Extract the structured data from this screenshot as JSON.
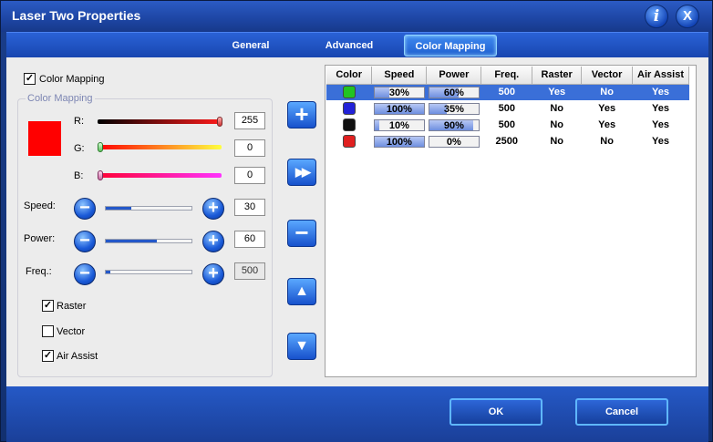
{
  "window": {
    "title": "Laser Two Properties",
    "info_icon": "i",
    "close_icon": "X"
  },
  "tabs": [
    {
      "label": "General"
    },
    {
      "label": "Advanced"
    },
    {
      "label": "Color Mapping",
      "active": true
    }
  ],
  "color_mapping_enabled": {
    "label": "Color Mapping",
    "checked": true
  },
  "group": {
    "title": "Color Mapping",
    "swatch_color": "#ff0000",
    "r": {
      "label": "R:",
      "value": "255"
    },
    "g": {
      "label": "G:",
      "value": "0"
    },
    "b": {
      "label": "B:",
      "value": "0"
    },
    "speed": {
      "label": "Speed:",
      "value": "30",
      "level": 0.3
    },
    "power": {
      "label": "Power:",
      "value": "60",
      "level": 0.6
    },
    "freq": {
      "label": "Freq.:",
      "value": "500",
      "level": 0.05
    },
    "raster": {
      "label": "Raster",
      "checked": true
    },
    "vector": {
      "label": "Vector",
      "checked": false
    },
    "air_assist": {
      "label": "Air Assist",
      "checked": true
    }
  },
  "side_buttons": {
    "add": "+",
    "fast_forward": "▶▶",
    "remove": "−",
    "move_up": "▲",
    "move_down": "▼"
  },
  "table": {
    "headers": [
      "Color",
      "Speed",
      "Power",
      "Freq.",
      "Raster",
      "Vector",
      "Air Assist"
    ],
    "rows": [
      {
        "color": "#22c422",
        "speed": "30%",
        "speed_level": 0.3,
        "power": "60%",
        "power_level": 0.6,
        "freq": "500",
        "raster": "Yes",
        "vector": "No",
        "air": "Yes",
        "selected": true
      },
      {
        "color": "#2222d8",
        "speed": "100%",
        "speed_level": 1.0,
        "power": "35%",
        "power_level": 0.35,
        "freq": "500",
        "raster": "No",
        "vector": "Yes",
        "air": "Yes"
      },
      {
        "color": "#111111",
        "speed": "10%",
        "speed_level": 0.1,
        "power": "90%",
        "power_level": 0.9,
        "freq": "500",
        "raster": "No",
        "vector": "Yes",
        "air": "Yes"
      },
      {
        "color": "#e02020",
        "speed": "100%",
        "speed_level": 1.0,
        "power": "0%",
        "power_level": 0.0,
        "freq": "2500",
        "raster": "No",
        "vector": "No",
        "air": "Yes"
      }
    ]
  },
  "footer": {
    "ok": "OK",
    "cancel": "Cancel"
  },
  "colors": {
    "accent": "#1d45a3",
    "selection": "#3a6fd8"
  }
}
